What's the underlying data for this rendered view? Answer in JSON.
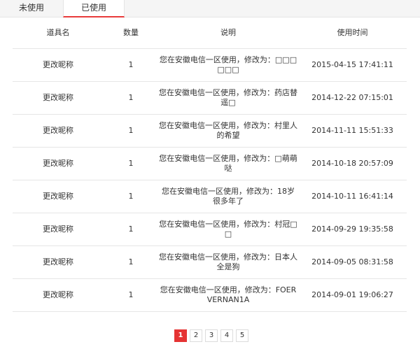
{
  "tabs": [
    {
      "label": "未使用",
      "active": false
    },
    {
      "label": "已使用",
      "active": true
    }
  ],
  "table": {
    "headers": [
      "道具名",
      "数量",
      "说明",
      "使用时间"
    ],
    "rows": [
      {
        "name": "更改昵称",
        "qty": "1",
        "desc": "您在安徽电信一区使用，修改为：□□□□□□",
        "time": "2015-04-15 17:41:11"
      },
      {
        "name": "更改昵称",
        "qty": "1",
        "desc": "您在安徽电信一区使用，修改为：药店替遥□",
        "time": "2014-12-22 07:15:01"
      },
      {
        "name": "更改昵称",
        "qty": "1",
        "desc": "您在安徽电信一区使用，修改为：村里人的希望",
        "time": "2014-11-11 15:51:33"
      },
      {
        "name": "更改昵称",
        "qty": "1",
        "desc": "您在安徽电信一区使用，修改为：□萌萌哒",
        "time": "2014-10-18 20:57:09"
      },
      {
        "name": "更改昵称",
        "qty": "1",
        "desc": "您在安徽电信一区使用，修改为：18岁很多年了",
        "time": "2014-10-11 16:41:14"
      },
      {
        "name": "更改昵称",
        "qty": "1",
        "desc": "您在安徽电信一区使用，修改为：村冠□□",
        "time": "2014-09-29 19:35:58"
      },
      {
        "name": "更改昵称",
        "qty": "1",
        "desc": "您在安徽电信一区使用，修改为：日本人全是狗",
        "time": "2014-09-05 08:31:58"
      },
      {
        "name": "更改昵称",
        "qty": "1",
        "desc": "您在安徽电信一区使用，修改为：FOERVERNAN1A",
        "time": "2014-09-01 19:06:27"
      }
    ]
  },
  "pagination": {
    "pages": [
      "1",
      "2",
      "3",
      "4",
      "5"
    ],
    "current": "1",
    "active_color": "#e53333"
  }
}
